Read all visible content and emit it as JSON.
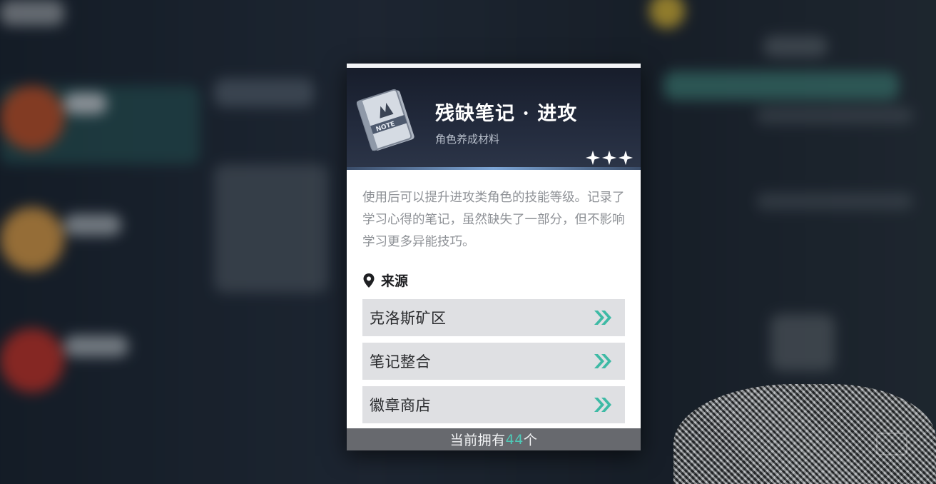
{
  "item": {
    "name": "残缺笔记 · 进攻",
    "type": "角色养成材料",
    "rarity_stars": 3,
    "icon": "note-book-icon",
    "description": "使用后可以提升进攻类角色的技能等级。记录了学习心得的笔记，虽然缺失了一部分，但不影响学习更多异能技巧。"
  },
  "source": {
    "title": "来源",
    "icon": "location-pin-icon",
    "items": [
      {
        "label": "克洛斯矿区",
        "icon": "double-chevron-right-icon"
      },
      {
        "label": "笔记整合",
        "icon": "double-chevron-right-icon"
      },
      {
        "label": "徽章商店",
        "icon": "double-chevron-right-icon"
      }
    ]
  },
  "footer": {
    "prefix": "当前拥有",
    "count": "44",
    "suffix": "个"
  },
  "colors": {
    "accent": "#4ec9b7",
    "header_bg": "#1d2434",
    "row_bg": "#dfe0e3",
    "footer_bg": "#67696e"
  }
}
